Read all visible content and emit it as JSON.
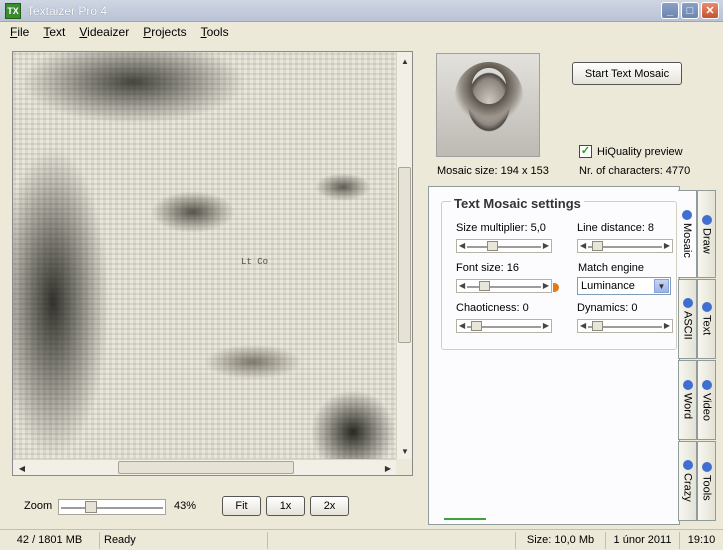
{
  "window": {
    "title": "Textaizer Pro 4",
    "icon": "TX"
  },
  "menu": [
    "File",
    "Text",
    "Videaizer",
    "Projects",
    "Tools"
  ],
  "preview": {
    "zoom_label": "Zoom",
    "zoom_value": "43%",
    "zoom_level": 0.43,
    "fit_label": "Fit",
    "one_x_label": "1x",
    "two_x_label": "2x",
    "center_text": "Lt Co"
  },
  "info": {
    "start_button": "Start Text Mosaic",
    "hq_label": "HiQuality preview",
    "hq_checked": true,
    "mosaic_size": "Mosaic size: 194 x 153",
    "num_chars": "Nr. of characters: 4770"
  },
  "settings": {
    "title": "Text Mosaic settings",
    "size_multiplier": "Size multiplier: 5,0",
    "line_distance": "Line distance: 8",
    "font_size": "Font size: 16",
    "match_engine_label": "Match engine",
    "match_engine_value": "Luminance",
    "chaoticness": "Chaoticness: 0",
    "dynamics": "Dynamics: 0"
  },
  "tabs_inner": [
    "Mosaic",
    "ASCII",
    "Word",
    "Crazy"
  ],
  "tabs_outer": [
    "Draw",
    "Text",
    "Video",
    "Tools"
  ],
  "status": {
    "memory": "42 / 1801 MB",
    "state": "Ready",
    "size": "Size: 10,0 Mb",
    "date": "1 únor 2011",
    "time": "19:10"
  },
  "colors": {
    "title_gradient_top": "#cfd6e3",
    "accent_orange": "#e07b18",
    "progress_green": "#3aa53a"
  }
}
